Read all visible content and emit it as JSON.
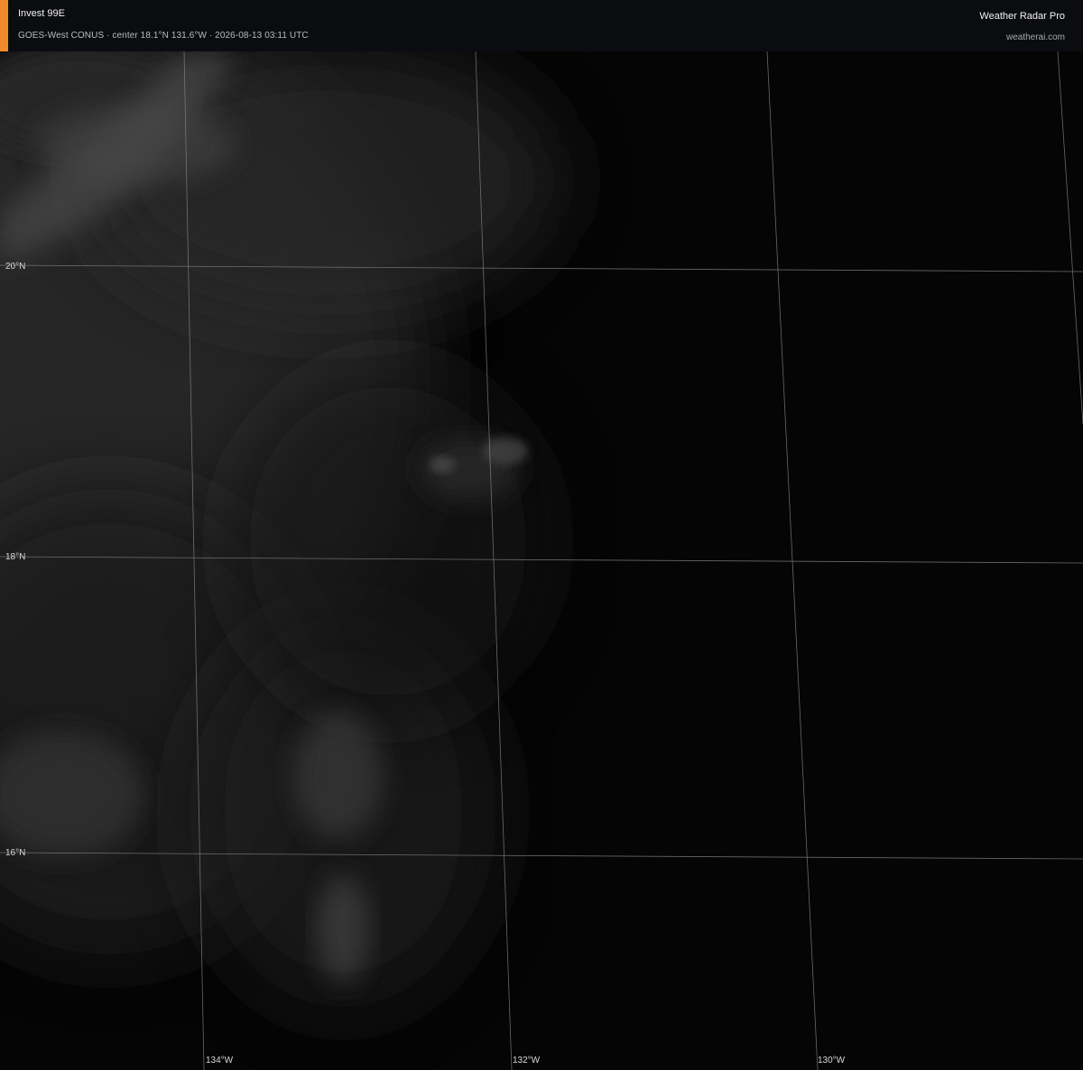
{
  "header": {
    "storm_name": "Invest 99E",
    "subtitle": "GOES-West CONUS · center 18.1°N 131.6°W · 2026-08-13 03:11 UTC",
    "brand": "Weather Radar Pro",
    "site": "weatherai.com"
  },
  "colors": {
    "accent": "#f08a2c",
    "header_bg": "#0b0c0f",
    "gridline": "#8a8a8a",
    "background": "#050505"
  },
  "map": {
    "latitude_labels": [
      "20°N",
      "18°N",
      "16°N"
    ],
    "longitude_labels": [
      "134°W",
      "132°W",
      "130°W"
    ]
  }
}
